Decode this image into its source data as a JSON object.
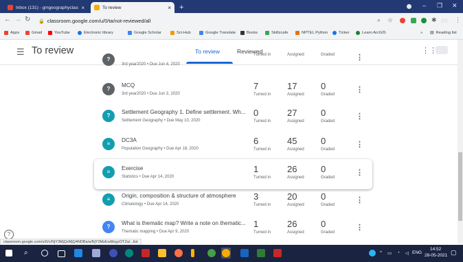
{
  "browser": {
    "tabs": [
      {
        "label": "Inbox (131) - gmgeographyclass",
        "active": false
      },
      {
        "label": "To review",
        "active": true
      }
    ],
    "new_tab": "+",
    "tab_close": "×",
    "url": "classroom.google.com/u/0/ta/not-reviewed/all",
    "bookmarks": [
      {
        "label": "Apps",
        "color": "#ea4335"
      },
      {
        "label": "Gmail",
        "color": "#ea4335"
      },
      {
        "label": "YouTube",
        "color": "#ff0000"
      },
      {
        "label": "Electronic library",
        "color": "#1a73e8"
      },
      {
        "label": "Google Scholar",
        "color": "#4285f4"
      },
      {
        "label": "Sci-Hub",
        "color": "#f29900"
      },
      {
        "label": "Google Translate",
        "color": "#4285f4"
      },
      {
        "label": "Books",
        "color": "#333333"
      },
      {
        "label": "Skillzcafe",
        "color": "#34a853"
      },
      {
        "label": "NPTEL Python",
        "color": "#e37400"
      },
      {
        "label": "Ticker",
        "color": "#1a73e8"
      },
      {
        "label": "Learn ArcGIS",
        "color": "#188038"
      }
    ],
    "reading_list": "Reading list",
    "bookmarks_more": "»",
    "status_url": "classroom.google.com/u/0/c/NjY3MjQxMjQ4NDBa/a/NjY3MzEwMzgzOTZa/...list"
  },
  "classroom": {
    "title": "To review",
    "tabs": [
      "To review",
      "Reviewed"
    ],
    "labels": {
      "turned_in": "Turned in",
      "assigned": "Assigned",
      "graded": "Graded"
    },
    "assignments": [
      {
        "title": "",
        "subtitle": "3rd year2020 • Due Jun 4, 2020",
        "turned_in": "",
        "assigned": "",
        "graded": "",
        "icon_color": "#5f6368",
        "icon": "?"
      },
      {
        "title": "MCQ",
        "subtitle": "3rd year2020 • Due Jun 3, 2020",
        "turned_in": "7",
        "assigned": "17",
        "graded": "0",
        "icon_color": "#5f6368",
        "icon": "?"
      },
      {
        "title": "Settlement Geography 1. Define settlement. Wh...",
        "subtitle": "Settlement Geography • Due May 10, 2020",
        "turned_in": "0",
        "assigned": "27",
        "graded": "0",
        "icon_color": "#129eaf",
        "icon": "?"
      },
      {
        "title": "DC3A",
        "subtitle": "Population Geography • Due Apr 18, 2020",
        "turned_in": "6",
        "assigned": "45",
        "graded": "0",
        "icon_color": "#129eaf",
        "icon": "≡"
      },
      {
        "title": "Exercise",
        "subtitle": "Statistics • Due Apr 14, 2020",
        "turned_in": "1",
        "assigned": "26",
        "graded": "0",
        "icon_color": "#129eaf",
        "icon": "≡"
      },
      {
        "title": "Origin, composition & structure of atmosphere",
        "subtitle": "Climatology • Due Apr 14, 2020",
        "turned_in": "3",
        "assigned": "20",
        "graded": "0",
        "icon_color": "#129eaf",
        "icon": "≡"
      },
      {
        "title": "What is thematic map? Write a note on thematic...",
        "subtitle": "Thematic mapping • Due Apr 9, 2020",
        "turned_in": "1",
        "assigned": "26",
        "graded": "0",
        "icon_color": "#4285f4",
        "icon": "?"
      }
    ]
  },
  "taskbar": {
    "lang": "ENG",
    "time": "14:52",
    "date": "28-05-2021"
  }
}
